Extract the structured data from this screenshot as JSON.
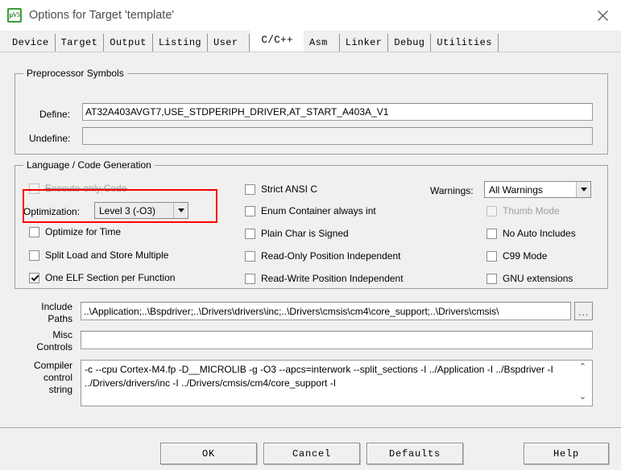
{
  "window": {
    "title": "Options for Target 'template'",
    "icon": "keil-uvision-icon",
    "icon_glyph": "µV5",
    "close_label": "×"
  },
  "tabs": [
    {
      "label": "Device",
      "active": false
    },
    {
      "label": "Target",
      "active": false
    },
    {
      "label": "Output",
      "active": false
    },
    {
      "label": "Listing",
      "active": false
    },
    {
      "label": "User",
      "active": false
    },
    {
      "label": "C/C++",
      "active": true
    },
    {
      "label": "Asm",
      "active": false
    },
    {
      "label": "Linker",
      "active": false
    },
    {
      "label": "Debug",
      "active": false
    },
    {
      "label": "Utilities",
      "active": false
    }
  ],
  "preprocessor": {
    "legend": "Preprocessor Symbols",
    "define_label": "Define:",
    "define_value": "AT32A403AVGT7,USE_STDPERIPH_DRIVER,AT_START_A403A_V1",
    "undefine_label": "Undefine:",
    "undefine_value": ""
  },
  "codegen": {
    "legend": "Language / Code Generation",
    "column_left": [
      {
        "label": "Execute-only Code",
        "checked": false,
        "disabled": true
      },
      {
        "label": "Optimize for Time",
        "checked": false,
        "disabled": false
      },
      {
        "label": "Split Load and Store Multiple",
        "checked": false,
        "disabled": false
      },
      {
        "label": "One ELF Section per Function",
        "checked": true,
        "disabled": false
      }
    ],
    "optimization_label": "Optimization:",
    "optimization_value": "Level 3 (-O3)",
    "column_middle": [
      {
        "label": "Strict ANSI C",
        "checked": false,
        "disabled": false
      },
      {
        "label": "Enum Container always int",
        "checked": false,
        "disabled": false
      },
      {
        "label": "Plain Char is Signed",
        "checked": false,
        "disabled": false
      },
      {
        "label": "Read-Only Position Independent",
        "checked": false,
        "disabled": false
      },
      {
        "label": "Read-Write Position Independent",
        "checked": false,
        "disabled": false
      }
    ],
    "warnings_label": "Warnings:",
    "warnings_value": "All Warnings",
    "column_right": [
      {
        "label": "Thumb Mode",
        "checked": false,
        "disabled": true
      },
      {
        "label": "No Auto Includes",
        "checked": false,
        "disabled": false
      },
      {
        "label": "C99 Mode",
        "checked": false,
        "disabled": false
      },
      {
        "label": "GNU extensions",
        "checked": false,
        "disabled": false
      }
    ]
  },
  "paths": {
    "include_label": "Include\nPaths",
    "include_value": "..\\Application;..\\Bspdriver;..\\Drivers\\drivers\\inc;..\\Drivers\\cmsis\\cm4\\core_support;..\\Drivers\\cmsis\\",
    "browse_label": "...",
    "misc_label": "Misc\nControls",
    "misc_value": "",
    "compiler_label": "Compiler\ncontrol\nstring",
    "compiler_value": "-c --cpu Cortex-M4.fp -D__MICROLIB -g -O3 --apcs=interwork --split_sections -I ../Application -I ../Bspdriver -I ../Drivers/drivers/inc -I ../Drivers/cmsis/cm4/core_support -I",
    "scroll_up": "⌃",
    "scroll_down": "⌄"
  },
  "buttons": {
    "ok": "OK",
    "cancel": "Cancel",
    "defaults": "Defaults",
    "help": "Help"
  },
  "annotation": {
    "highlight_color": "#ff0000",
    "target": "optimization-row"
  }
}
